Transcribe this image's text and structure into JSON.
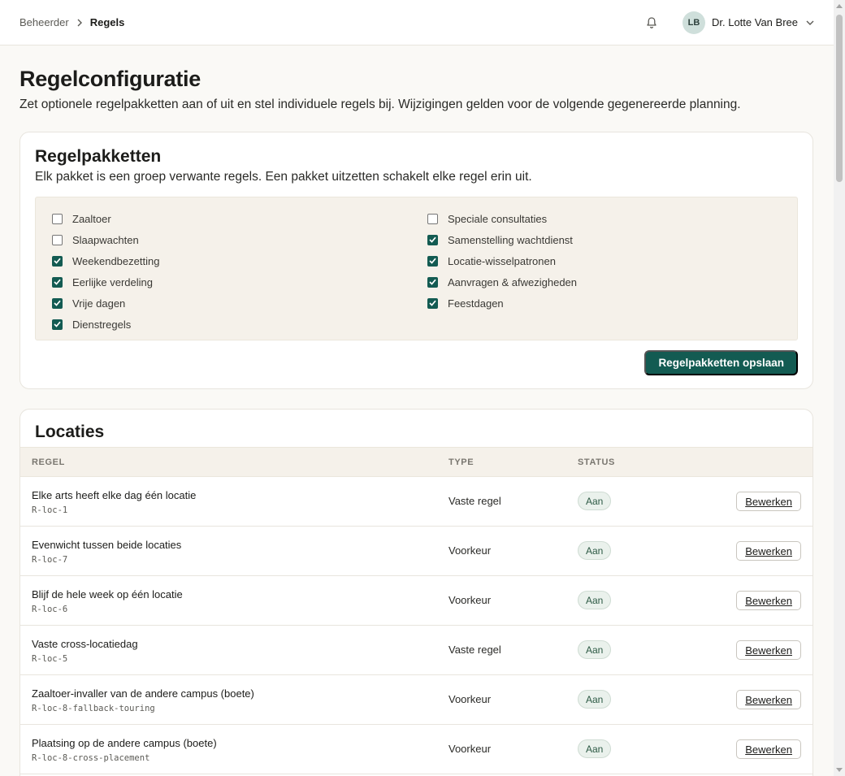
{
  "breadcrumb": {
    "parent": "Beheerder",
    "current": "Regels"
  },
  "user": {
    "initials": "LB",
    "name": "Dr. Lotte Van Bree"
  },
  "page": {
    "title": "Regelconfiguratie",
    "description": "Zet optionele regelpakketten aan of uit en stel individuele regels bij. Wijzigingen gelden voor de volgende gegenereerde planning."
  },
  "packs": {
    "title": "Regelpakketten",
    "subtitle": "Elk pakket is een groep verwante regels. Een pakket uitzetten schakelt elke regel erin uit.",
    "left": [
      {
        "label": "Zaaltoer",
        "checked": false
      },
      {
        "label": "Slaapwachten",
        "checked": false
      },
      {
        "label": "Weekendbezetting",
        "checked": true
      },
      {
        "label": "Eerlijke verdeling",
        "checked": true
      },
      {
        "label": "Vrije dagen",
        "checked": true
      },
      {
        "label": "Dienstregels",
        "checked": true
      }
    ],
    "right": [
      {
        "label": "Speciale consultaties",
        "checked": false
      },
      {
        "label": "Samenstelling wachtdienst",
        "checked": true
      },
      {
        "label": "Locatie-wisselpatronen",
        "checked": true
      },
      {
        "label": "Aanvragen & afwezigheden",
        "checked": true
      },
      {
        "label": "Feestdagen",
        "checked": true
      }
    ],
    "save_label": "Regelpakketten opslaan"
  },
  "locations": {
    "title": "Locaties",
    "columns": {
      "rule": "REGEL",
      "type": "TYPE",
      "status": "STATUS"
    },
    "edit_label": "Bewerken",
    "rows": [
      {
        "name": "Elke arts heeft elke dag één locatie",
        "id": "R-loc-1",
        "type": "Vaste regel",
        "status": "Aan"
      },
      {
        "name": "Evenwicht tussen beide locaties",
        "id": "R-loc-7",
        "type": "Voorkeur",
        "status": "Aan"
      },
      {
        "name": "Blijf de hele week op één locatie",
        "id": "R-loc-6",
        "type": "Voorkeur",
        "status": "Aan"
      },
      {
        "name": "Vaste cross-locatiedag",
        "id": "R-loc-5",
        "type": "Vaste regel",
        "status": "Aan"
      },
      {
        "name": "Zaaltoer-invaller van de andere campus (boete)",
        "id": "R-loc-8-fallback-touring",
        "type": "Voorkeur",
        "status": "Aan"
      },
      {
        "name": "Plaatsing op de andere campus (boete)",
        "id": "R-loc-8-cross-placement",
        "type": "Voorkeur",
        "status": "Aan"
      }
    ]
  }
}
